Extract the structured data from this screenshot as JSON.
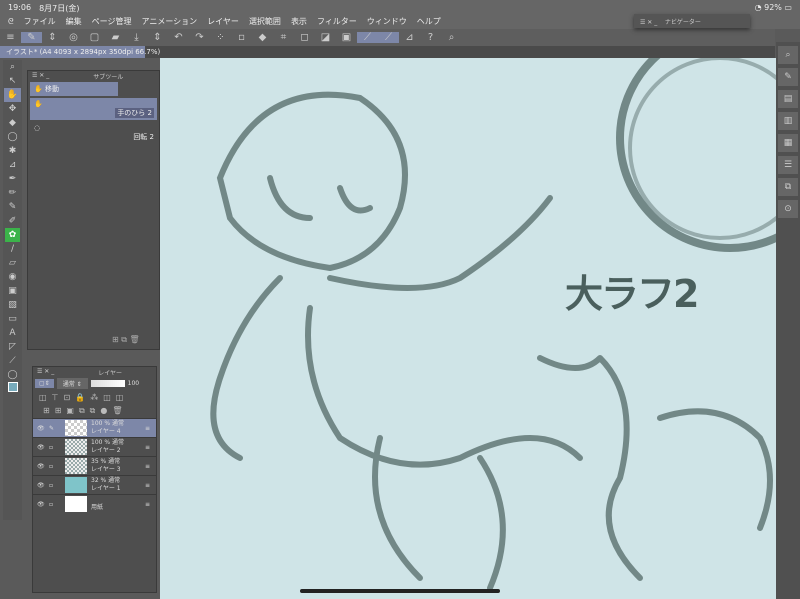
{
  "status": {
    "time": "19:06",
    "date": "8月7日(金)",
    "battery": "92%"
  },
  "menu": [
    "ファイル",
    "編集",
    "ページ管理",
    "アニメーション",
    "レイヤー",
    "選択範囲",
    "表示",
    "フィルター",
    "ウィンドウ",
    "ヘルプ"
  ],
  "tab": {
    "title": "イラスト* (A4 4093 x 2894px 350dpi 66.7%)"
  },
  "navigator": {
    "title": "ナビゲーター"
  },
  "subtool": {
    "title": "サブツール",
    "group": "移動",
    "items": [
      {
        "label": "手のひら 2",
        "selected": true
      },
      {
        "label": "回転 2",
        "selected": false
      }
    ]
  },
  "layers": {
    "title": "レイヤー",
    "blend": "通常",
    "opacity": "100",
    "rows": [
      {
        "info": "100 % 通常",
        "name": "レイヤー 4",
        "selected": true,
        "thumb": "transparent"
      },
      {
        "info": "100 % 通常",
        "name": "レイヤー 2",
        "selected": false,
        "thumb": "sketch"
      },
      {
        "info": "35 % 通常",
        "name": "レイヤー 3",
        "selected": false,
        "thumb": "sketch"
      },
      {
        "info": "32 % 通常",
        "name": "レイヤー 1",
        "selected": false,
        "thumb": "#7fc4c9"
      },
      {
        "info": "",
        "name": "用紙",
        "selected": false,
        "thumb": "#ffffff"
      }
    ]
  },
  "canvas": {
    "text": "大ラフ2",
    "background": "#cfe4e7",
    "stroke": "#5c7270"
  },
  "colors": {
    "accent": "#7d87a8",
    "chrome": "#5e5e5e"
  }
}
